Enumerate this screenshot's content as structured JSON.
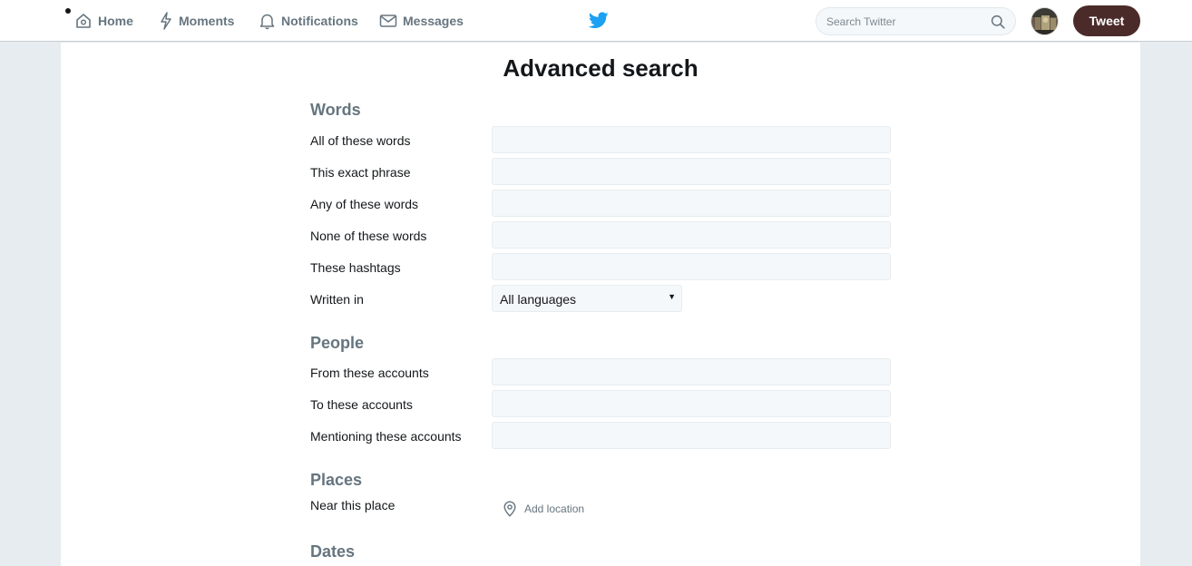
{
  "nav": {
    "home": "Home",
    "moments": "Moments",
    "notifications": "Notifications",
    "messages": "Messages"
  },
  "search": {
    "placeholder": "Search Twitter"
  },
  "tweet_button": "Tweet",
  "colors": {
    "tweet_button_bg": "#4b2a2a",
    "brand_blue": "#1da1f2"
  },
  "page": {
    "title": "Advanced search"
  },
  "words": {
    "heading": "Words",
    "fields": [
      {
        "label": "All of these words",
        "value": ""
      },
      {
        "label": "This exact phrase",
        "value": ""
      },
      {
        "label": "Any of these words",
        "value": ""
      },
      {
        "label": "None of these words",
        "value": ""
      },
      {
        "label": "These hashtags",
        "value": ""
      }
    ],
    "language": {
      "label": "Written in",
      "selected": "All languages"
    }
  },
  "people": {
    "heading": "People",
    "fields": [
      {
        "label": "From these accounts",
        "value": ""
      },
      {
        "label": "To these accounts",
        "value": ""
      },
      {
        "label": "Mentioning these accounts",
        "value": ""
      }
    ]
  },
  "places": {
    "heading": "Places",
    "label": "Near this place",
    "add_location": "Add location"
  },
  "dates": {
    "heading": "Dates"
  }
}
